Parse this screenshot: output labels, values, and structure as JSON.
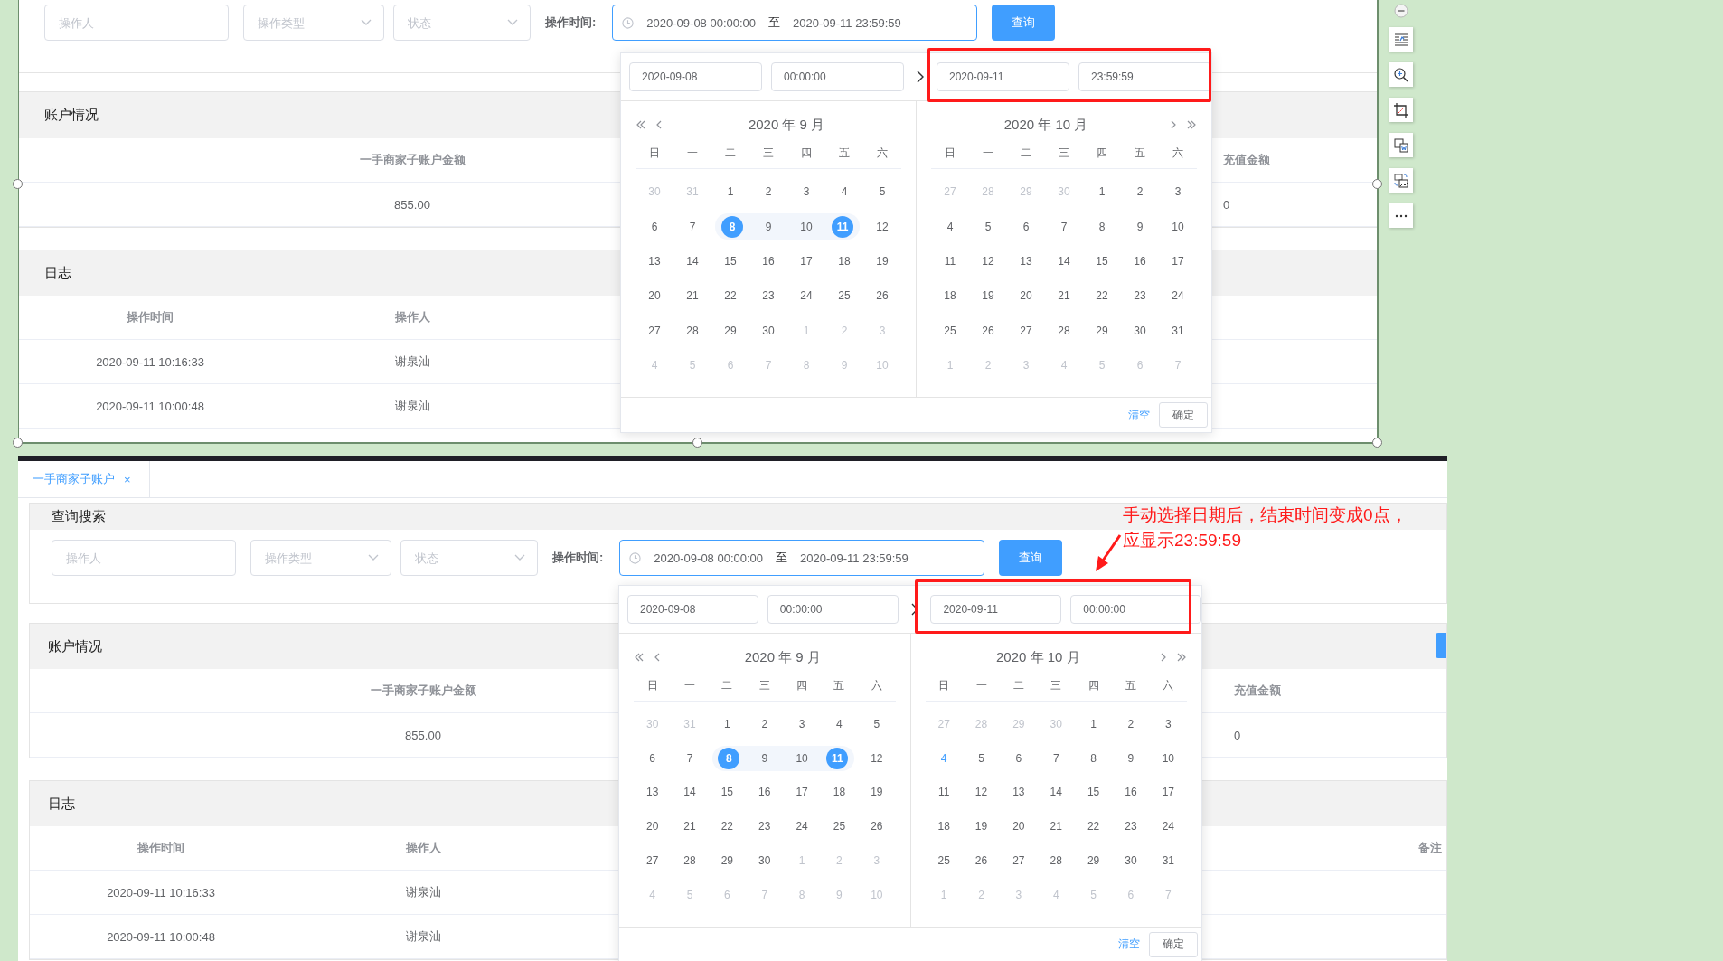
{
  "panels": [
    {
      "kind": "cropped",
      "filters": {
        "operator": {
          "placeholder": "操作人"
        },
        "type": {
          "placeholder": "操作类型"
        },
        "status": {
          "placeholder": "状态"
        },
        "time_label": "操作时间:"
      },
      "range": {
        "start": "2020-09-08 00:00:00",
        "separator": "至",
        "end": "2020-09-11 23:59:59"
      },
      "query_button": "查询",
      "account": {
        "title": "账户情况",
        "columns": [
          "一手商家子账户金额",
          "充值金额"
        ],
        "values": [
          "855.00",
          "0"
        ]
      },
      "log": {
        "title": "日志",
        "columns": [
          "操作时间",
          "操作人"
        ],
        "rows": [
          [
            "2020-09-11 10:16:33",
            "谢泉汕"
          ],
          [
            "2020-09-11 10:00:48",
            "谢泉汕"
          ]
        ]
      },
      "picker": {
        "start_date": "2020-09-08",
        "start_time": "00:00:00",
        "end_date": "2020-09-11",
        "end_time": "23:59:59",
        "highlighted": true,
        "clear": "清空",
        "confirm": "确定",
        "calendars": [
          {
            "kind": "left",
            "title": "2020 年 9 月",
            "weekdays": [
              "日",
              "一",
              "二",
              "三",
              "四",
              "五",
              "六"
            ],
            "weeks": [
              [
                {
                  "label": "30",
                  "kind": "other",
                  "selected": false
                },
                {
                  "label": "31",
                  "kind": "other",
                  "selected": false
                },
                {
                  "label": "1",
                  "kind": "day",
                  "selected": false
                },
                {
                  "label": "2",
                  "kind": "day",
                  "selected": false
                },
                {
                  "label": "3",
                  "kind": "day",
                  "selected": false
                },
                {
                  "label": "4",
                  "kind": "day",
                  "selected": false
                },
                {
                  "label": "5",
                  "kind": "day",
                  "selected": false
                }
              ],
              [
                {
                  "label": "6",
                  "kind": "day",
                  "selected": false
                },
                {
                  "label": "7",
                  "kind": "day",
                  "selected": false
                },
                {
                  "label": "8",
                  "kind": "range",
                  "selected": true
                },
                {
                  "label": "9",
                  "kind": "range",
                  "selected": false
                },
                {
                  "label": "10",
                  "kind": "range",
                  "selected": false
                },
                {
                  "label": "11",
                  "kind": "range",
                  "selected": true
                },
                {
                  "label": "12",
                  "kind": "day",
                  "selected": false
                }
              ],
              [
                {
                  "label": "13",
                  "kind": "day",
                  "selected": false
                },
                {
                  "label": "14",
                  "kind": "day",
                  "selected": false
                },
                {
                  "label": "15",
                  "kind": "day",
                  "selected": false
                },
                {
                  "label": "16",
                  "kind": "day",
                  "selected": false
                },
                {
                  "label": "17",
                  "kind": "day",
                  "selected": false
                },
                {
                  "label": "18",
                  "kind": "day",
                  "selected": false
                },
                {
                  "label": "19",
                  "kind": "day",
                  "selected": false
                }
              ],
              [
                {
                  "label": "20",
                  "kind": "day",
                  "selected": false
                },
                {
                  "label": "21",
                  "kind": "day",
                  "selected": false
                },
                {
                  "label": "22",
                  "kind": "day",
                  "selected": false
                },
                {
                  "label": "23",
                  "kind": "day",
                  "selected": false
                },
                {
                  "label": "24",
                  "kind": "day",
                  "selected": false
                },
                {
                  "label": "25",
                  "kind": "day",
                  "selected": false
                },
                {
                  "label": "26",
                  "kind": "day",
                  "selected": false
                }
              ],
              [
                {
                  "label": "27",
                  "kind": "day",
                  "selected": false
                },
                {
                  "label": "28",
                  "kind": "day",
                  "selected": false
                },
                {
                  "label": "29",
                  "kind": "day",
                  "selected": false
                },
                {
                  "label": "30",
                  "kind": "day",
                  "selected": false
                },
                {
                  "label": "1",
                  "kind": "other",
                  "selected": false
                },
                {
                  "label": "2",
                  "kind": "other",
                  "selected": false
                },
                {
                  "label": "3",
                  "kind": "other",
                  "selected": false
                }
              ],
              [
                {
                  "label": "4",
                  "kind": "other",
                  "selected": false
                },
                {
                  "label": "5",
                  "kind": "other",
                  "selected": false
                },
                {
                  "label": "6",
                  "kind": "other",
                  "selected": false
                },
                {
                  "label": "7",
                  "kind": "other",
                  "selected": false
                },
                {
                  "label": "8",
                  "kind": "other",
                  "selected": false
                },
                {
                  "label": "9",
                  "kind": "other",
                  "selected": false
                },
                {
                  "label": "10",
                  "kind": "other",
                  "selected": false
                }
              ]
            ]
          },
          {
            "kind": "right",
            "title": "2020 年 10 月",
            "weekdays": [
              "日",
              "一",
              "二",
              "三",
              "四",
              "五",
              "六"
            ],
            "weeks": [
              [
                {
                  "label": "27",
                  "kind": "other",
                  "selected": false
                },
                {
                  "label": "28",
                  "kind": "other",
                  "selected": false
                },
                {
                  "label": "29",
                  "kind": "other",
                  "selected": false
                },
                {
                  "label": "30",
                  "kind": "other",
                  "selected": false
                },
                {
                  "label": "1",
                  "kind": "day",
                  "selected": false
                },
                {
                  "label": "2",
                  "kind": "day",
                  "selected": false
                },
                {
                  "label": "3",
                  "kind": "day",
                  "selected": false
                }
              ],
              [
                {
                  "label": "4",
                  "kind": "day",
                  "selected": false
                },
                {
                  "label": "5",
                  "kind": "day",
                  "selected": false
                },
                {
                  "label": "6",
                  "kind": "day",
                  "selected": false
                },
                {
                  "label": "7",
                  "kind": "day",
                  "selected": false
                },
                {
                  "label": "8",
                  "kind": "day",
                  "selected": false
                },
                {
                  "label": "9",
                  "kind": "day",
                  "selected": false
                },
                {
                  "label": "10",
                  "kind": "day",
                  "selected": false
                }
              ],
              [
                {
                  "label": "11",
                  "kind": "day",
                  "selected": false
                },
                {
                  "label": "12",
                  "kind": "day",
                  "selected": false
                },
                {
                  "label": "13",
                  "kind": "day",
                  "selected": false
                },
                {
                  "label": "14",
                  "kind": "day",
                  "selected": false
                },
                {
                  "label": "15",
                  "kind": "day",
                  "selected": false
                },
                {
                  "label": "16",
                  "kind": "day",
                  "selected": false
                },
                {
                  "label": "17",
                  "kind": "day",
                  "selected": false
                }
              ],
              [
                {
                  "label": "18",
                  "kind": "day",
                  "selected": false
                },
                {
                  "label": "19",
                  "kind": "day",
                  "selected": false
                },
                {
                  "label": "20",
                  "kind": "day",
                  "selected": false
                },
                {
                  "label": "21",
                  "kind": "day",
                  "selected": false
                },
                {
                  "label": "22",
                  "kind": "day",
                  "selected": false
                },
                {
                  "label": "23",
                  "kind": "day",
                  "selected": false
                },
                {
                  "label": "24",
                  "kind": "day",
                  "selected": false
                }
              ],
              [
                {
                  "label": "25",
                  "kind": "day",
                  "selected": false
                },
                {
                  "label": "26",
                  "kind": "day",
                  "selected": false
                },
                {
                  "label": "27",
                  "kind": "day",
                  "selected": false
                },
                {
                  "label": "28",
                  "kind": "day",
                  "selected": false
                },
                {
                  "label": "29",
                  "kind": "day",
                  "selected": false
                },
                {
                  "label": "30",
                  "kind": "day",
                  "selected": false
                },
                {
                  "label": "31",
                  "kind": "day",
                  "selected": false
                }
              ],
              [
                {
                  "label": "1",
                  "kind": "other",
                  "selected": false
                },
                {
                  "label": "2",
                  "kind": "other",
                  "selected": false
                },
                {
                  "label": "3",
                  "kind": "other",
                  "selected": false
                },
                {
                  "label": "4",
                  "kind": "other",
                  "selected": false
                },
                {
                  "label": "5",
                  "kind": "other",
                  "selected": false
                },
                {
                  "label": "6",
                  "kind": "other",
                  "selected": false
                },
                {
                  "label": "7",
                  "kind": "other",
                  "selected": false
                }
              ]
            ]
          }
        ]
      }
    },
    {
      "kind": "full",
      "tab": {
        "label": "一手商家子账户",
        "close": "×",
        "selected": true
      },
      "search_title": "查询搜索",
      "filters": {
        "operator": {
          "placeholder": "操作人"
        },
        "type": {
          "placeholder": "操作类型"
        },
        "status": {
          "placeholder": "状态"
        },
        "time_label": "操作时间:"
      },
      "range": {
        "start": "2020-09-08 00:00:00",
        "separator": "至",
        "end": "2020-09-11 23:59:59"
      },
      "query_button": "查询",
      "account": {
        "title": "账户情况",
        "columns": [
          "一手商家子账户金额",
          "充值金额"
        ],
        "values": [
          "855.00",
          "0"
        ]
      },
      "log": {
        "title": "日志",
        "columns": [
          "操作时间",
          "操作人",
          "备注"
        ],
        "rows": [
          [
            "2020-09-11 10:16:33",
            "谢泉汕"
          ],
          [
            "2020-09-11 10:00:48",
            "谢泉汕"
          ]
        ]
      },
      "picker": {
        "start_date": "2020-09-08",
        "start_time": "00:00:00",
        "end_date": "2020-09-11",
        "end_time": "00:00:00",
        "highlighted": true,
        "clear": "清空",
        "confirm": "确定",
        "calendars": [
          {
            "kind": "left",
            "title": "2020 年 9 月",
            "weekdays": [
              "日",
              "一",
              "二",
              "三",
              "四",
              "五",
              "六"
            ],
            "weeks": [
              [
                {
                  "label": "30",
                  "kind": "other",
                  "selected": false
                },
                {
                  "label": "31",
                  "kind": "other",
                  "selected": false
                },
                {
                  "label": "1",
                  "kind": "day",
                  "selected": false
                },
                {
                  "label": "2",
                  "kind": "day",
                  "selected": false
                },
                {
                  "label": "3",
                  "kind": "day",
                  "selected": false
                },
                {
                  "label": "4",
                  "kind": "day",
                  "selected": false
                },
                {
                  "label": "5",
                  "kind": "day",
                  "selected": false
                }
              ],
              [
                {
                  "label": "6",
                  "kind": "day",
                  "selected": false
                },
                {
                  "label": "7",
                  "kind": "day",
                  "selected": false
                },
                {
                  "label": "8",
                  "kind": "range",
                  "selected": true
                },
                {
                  "label": "9",
                  "kind": "range",
                  "selected": false
                },
                {
                  "label": "10",
                  "kind": "range",
                  "selected": false
                },
                {
                  "label": "11",
                  "kind": "range",
                  "selected": true
                },
                {
                  "label": "12",
                  "kind": "day",
                  "selected": false
                }
              ],
              [
                {
                  "label": "13",
                  "kind": "day",
                  "selected": false
                },
                {
                  "label": "14",
                  "kind": "day",
                  "selected": false
                },
                {
                  "label": "15",
                  "kind": "day",
                  "selected": false
                },
                {
                  "label": "16",
                  "kind": "day",
                  "selected": false
                },
                {
                  "label": "17",
                  "kind": "day",
                  "selected": false
                },
                {
                  "label": "18",
                  "kind": "day",
                  "selected": false
                },
                {
                  "label": "19",
                  "kind": "day",
                  "selected": false
                }
              ],
              [
                {
                  "label": "20",
                  "kind": "day",
                  "selected": false
                },
                {
                  "label": "21",
                  "kind": "day",
                  "selected": false
                },
                {
                  "label": "22",
                  "kind": "day",
                  "selected": false
                },
                {
                  "label": "23",
                  "kind": "day",
                  "selected": false
                },
                {
                  "label": "24",
                  "kind": "day",
                  "selected": false
                },
                {
                  "label": "25",
                  "kind": "day",
                  "selected": false
                },
                {
                  "label": "26",
                  "kind": "day",
                  "selected": false
                }
              ],
              [
                {
                  "label": "27",
                  "kind": "day",
                  "selected": false
                },
                {
                  "label": "28",
                  "kind": "day",
                  "selected": false
                },
                {
                  "label": "29",
                  "kind": "day",
                  "selected": false
                },
                {
                  "label": "30",
                  "kind": "day",
                  "selected": false
                },
                {
                  "label": "1",
                  "kind": "other",
                  "selected": false
                },
                {
                  "label": "2",
                  "kind": "other",
                  "selected": false
                },
                {
                  "label": "3",
                  "kind": "other",
                  "selected": false
                }
              ],
              [
                {
                  "label": "4",
                  "kind": "other",
                  "selected": false
                },
                {
                  "label": "5",
                  "kind": "other",
                  "selected": false
                },
                {
                  "label": "6",
                  "kind": "other",
                  "selected": false
                },
                {
                  "label": "7",
                  "kind": "other",
                  "selected": false
                },
                {
                  "label": "8",
                  "kind": "other",
                  "selected": false
                },
                {
                  "label": "9",
                  "kind": "other",
                  "selected": false
                },
                {
                  "label": "10",
                  "kind": "other",
                  "selected": false
                }
              ]
            ]
          },
          {
            "kind": "right",
            "title": "2020 年 10 月",
            "weekdays": [
              "日",
              "一",
              "二",
              "三",
              "四",
              "五",
              "六"
            ],
            "weeks": [
              [
                {
                  "label": "27",
                  "kind": "other",
                  "selected": false
                },
                {
                  "label": "28",
                  "kind": "other",
                  "selected": false
                },
                {
                  "label": "29",
                  "kind": "other",
                  "selected": false
                },
                {
                  "label": "30",
                  "kind": "other",
                  "selected": false
                },
                {
                  "label": "1",
                  "kind": "day",
                  "selected": false
                },
                {
                  "label": "2",
                  "kind": "day",
                  "selected": false
                },
                {
                  "label": "3",
                  "kind": "day",
                  "selected": false
                }
              ],
              [
                {
                  "label": "4",
                  "kind": "today",
                  "selected": false
                },
                {
                  "label": "5",
                  "kind": "day",
                  "selected": false
                },
                {
                  "label": "6",
                  "kind": "day",
                  "selected": false
                },
                {
                  "label": "7",
                  "kind": "day",
                  "selected": false
                },
                {
                  "label": "8",
                  "kind": "day",
                  "selected": false
                },
                {
                  "label": "9",
                  "kind": "day",
                  "selected": false
                },
                {
                  "label": "10",
                  "kind": "day",
                  "selected": false
                }
              ],
              [
                {
                  "label": "11",
                  "kind": "day",
                  "selected": false
                },
                {
                  "label": "12",
                  "kind": "day",
                  "selected": false
                },
                {
                  "label": "13",
                  "kind": "day",
                  "selected": false
                },
                {
                  "label": "14",
                  "kind": "day",
                  "selected": false
                },
                {
                  "label": "15",
                  "kind": "day",
                  "selected": false
                },
                {
                  "label": "16",
                  "kind": "day",
                  "selected": false
                },
                {
                  "label": "17",
                  "kind": "day",
                  "selected": false
                }
              ],
              [
                {
                  "label": "18",
                  "kind": "day",
                  "selected": false
                },
                {
                  "label": "19",
                  "kind": "day",
                  "selected": false
                },
                {
                  "label": "20",
                  "kind": "day",
                  "selected": false
                },
                {
                  "label": "21",
                  "kind": "day",
                  "selected": false
                },
                {
                  "label": "22",
                  "kind": "day",
                  "selected": false
                },
                {
                  "label": "23",
                  "kind": "day",
                  "selected": false
                },
                {
                  "label": "24",
                  "kind": "day",
                  "selected": false
                }
              ],
              [
                {
                  "label": "25",
                  "kind": "day",
                  "selected": false
                },
                {
                  "label": "26",
                  "kind": "day",
                  "selected": false
                },
                {
                  "label": "27",
                  "kind": "day",
                  "selected": false
                },
                {
                  "label": "28",
                  "kind": "day",
                  "selected": false
                },
                {
                  "label": "29",
                  "kind": "day",
                  "selected": false
                },
                {
                  "label": "30",
                  "kind": "day",
                  "selected": false
                },
                {
                  "label": "31",
                  "kind": "day",
                  "selected": false
                }
              ],
              [
                {
                  "label": "1",
                  "kind": "other",
                  "selected": false
                },
                {
                  "label": "2",
                  "kind": "other",
                  "selected": false
                },
                {
                  "label": "3",
                  "kind": "other",
                  "selected": false
                },
                {
                  "label": "4",
                  "kind": "other",
                  "selected": false
                },
                {
                  "label": "5",
                  "kind": "other",
                  "selected": false
                },
                {
                  "label": "6",
                  "kind": "other",
                  "selected": false
                },
                {
                  "label": "7",
                  "kind": "other",
                  "selected": false
                }
              ]
            ]
          }
        ]
      },
      "annotation": {
        "lines": [
          "手动选择日期后，结束时间变成0点，",
          "应显示23:59:59"
        ]
      }
    }
  ]
}
